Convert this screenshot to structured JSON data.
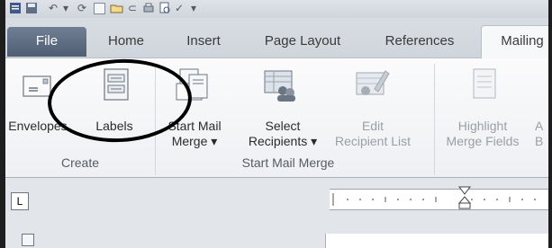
{
  "tabs": {
    "file": "File",
    "home": "Home",
    "insert": "Insert",
    "page_layout": "Page Layout",
    "references": "References",
    "mailings": "Mailing"
  },
  "ribbon": {
    "envelopes": "Envelopes",
    "labels": "Labels",
    "start_mail_merge_1": "Start Mail",
    "start_mail_merge_2": "Merge ▾",
    "select_recipients_1": "Select",
    "select_recipients_2": "Recipients ▾",
    "edit_list_1": "Edit",
    "edit_list_2": "Recipient List",
    "highlight_1": "Highlight",
    "highlight_2": "Merge Fields",
    "next_1": "A",
    "next_2": "B",
    "group_create": "Create",
    "group_start_mail_merge": "Start Mail Merge"
  },
  "tab_selector": "L"
}
